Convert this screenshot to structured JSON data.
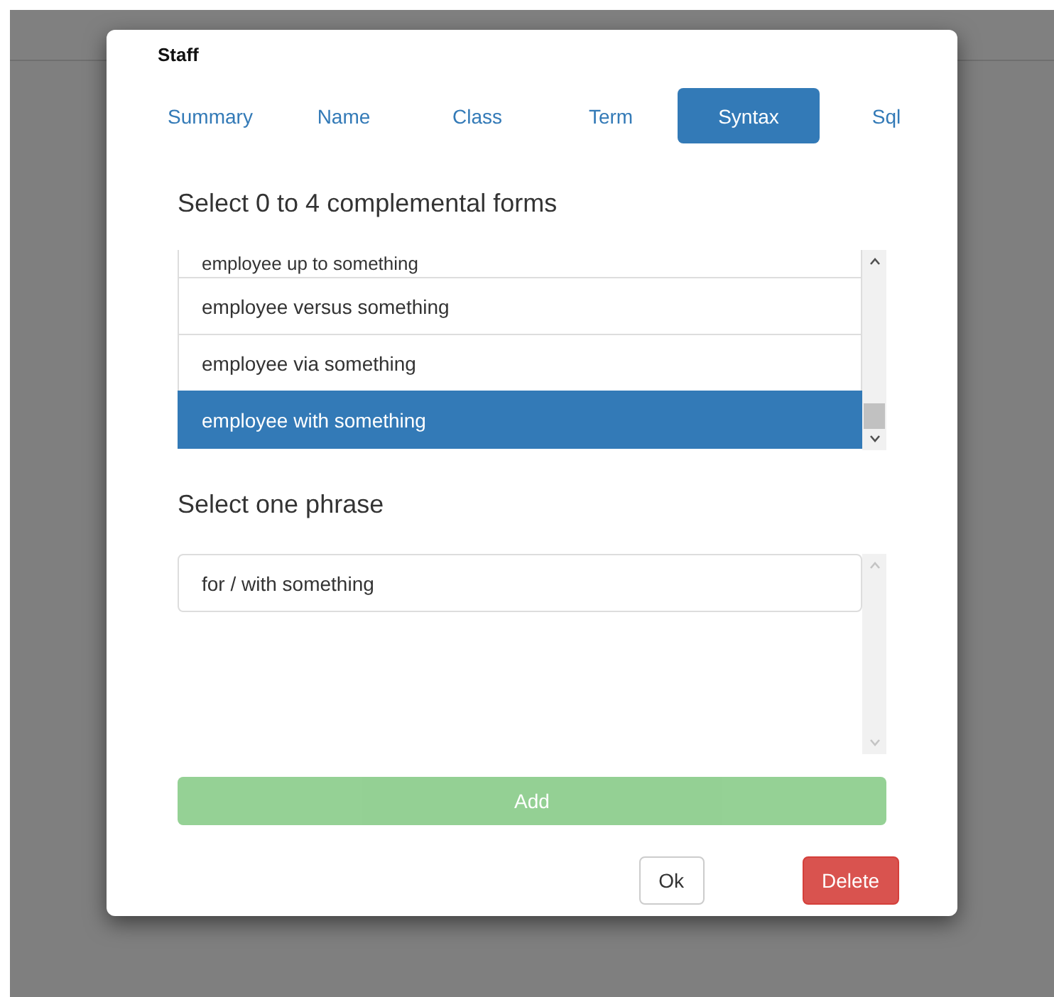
{
  "dialog": {
    "title": "Staff"
  },
  "tabs": [
    {
      "label": "Summary",
      "selected": false
    },
    {
      "label": "Name",
      "selected": false
    },
    {
      "label": "Class",
      "selected": false
    },
    {
      "label": "Term",
      "selected": false
    },
    {
      "label": "Syntax",
      "selected": true
    },
    {
      "label": "Sql",
      "selected": false
    }
  ],
  "forms": {
    "heading": "Select 0 to 4 complemental forms",
    "items": [
      {
        "label": "employee up to something",
        "selected": false
      },
      {
        "label": "employee versus something",
        "selected": false
      },
      {
        "label": "employee via something",
        "selected": false
      },
      {
        "label": "employee with something",
        "selected": true
      }
    ]
  },
  "phrases": {
    "heading": "Select one phrase",
    "items": [
      {
        "label": "for / with something",
        "selected": false
      }
    ]
  },
  "add_button": {
    "label": "Add",
    "disabled": true
  },
  "buttons": [
    {
      "label": "Ok",
      "kind": "default"
    },
    {
      "label": "Delete",
      "kind": "danger"
    }
  ]
}
